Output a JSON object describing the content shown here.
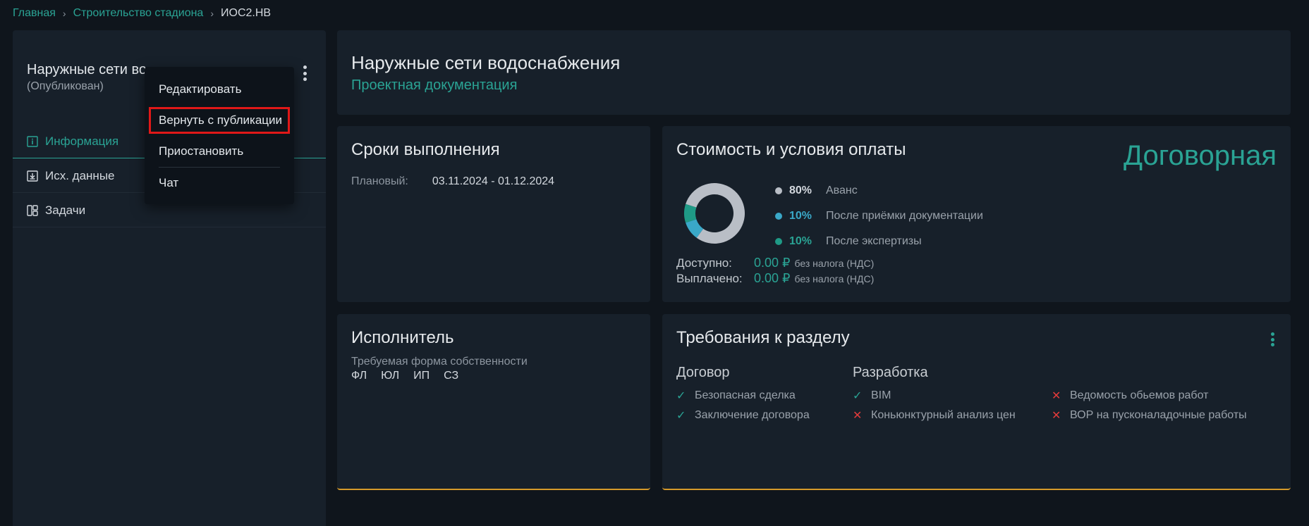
{
  "breadcrumb": {
    "home": "Главная",
    "project": "Строительство стадиона",
    "current": "ИОС2.НВ",
    "sep": "›"
  },
  "sidebar": {
    "title": "Наружные сети водоснабжения",
    "status": "(Опубликован)",
    "items": [
      {
        "label": "Информация",
        "icon": "info-icon"
      },
      {
        "label": "Исх. данные",
        "icon": "download-box-icon"
      },
      {
        "label": "Задачи",
        "icon": "kanban-icon"
      }
    ]
  },
  "menu": {
    "items": [
      "Редактировать",
      "Вернуть с публикации",
      "Приостановить",
      "Чат"
    ]
  },
  "header": {
    "title": "Наружные сети водоснабжения",
    "subtitle": "Проектная документация"
  },
  "terms": {
    "title": "Сроки выполнения",
    "planned_label": "Плановый:",
    "planned_value": "03.11.2024 - 01.12.2024"
  },
  "cost": {
    "title": "Стоимость и условия оплаты",
    "price": "Договорная",
    "legend": [
      {
        "pct": "80%",
        "label": "Аванс",
        "color": "#b9bec6"
      },
      {
        "pct": "10%",
        "label": "После приёмки документации",
        "color": "#3aa8c8"
      },
      {
        "pct": "10%",
        "label": "После экспертизы",
        "color": "#1f9a86"
      }
    ],
    "available_label": "Доступно:",
    "available_value": "0.00 ₽",
    "available_note": "без налога (НДС)",
    "paid_label": "Выплачено:",
    "paid_value": "0.00 ₽",
    "paid_note": "без налога (НДС)"
  },
  "executor": {
    "title": "Исполнитель",
    "subtitle": "Требуемая форма собственности",
    "forms": [
      "ФЛ",
      "ЮЛ",
      "ИП",
      "СЗ"
    ]
  },
  "requirements": {
    "title": "Требования к разделу",
    "contract_head": "Договор",
    "dev_head": "Разработка",
    "contract_items": [
      {
        "label": "Безопасная сделка",
        "ok": true
      },
      {
        "label": "Заключение договора",
        "ok": true
      }
    ],
    "dev_items": [
      {
        "label": "BIM",
        "ok": true
      },
      {
        "label": "Коньюнктурный анализ цен",
        "ok": false
      }
    ],
    "extra_items": [
      {
        "label": "Ведомость обьемов работ",
        "ok": false
      },
      {
        "label": "ВОР на пусконаладочные работы",
        "ok": false
      }
    ]
  },
  "chart_data": {
    "type": "pie",
    "categories": [
      "Аванс",
      "После приёмки документации",
      "После экспертизы"
    ],
    "values": [
      80,
      10,
      10
    ],
    "colors": [
      "#b9bec6",
      "#3aa8c8",
      "#1f9a86"
    ]
  }
}
